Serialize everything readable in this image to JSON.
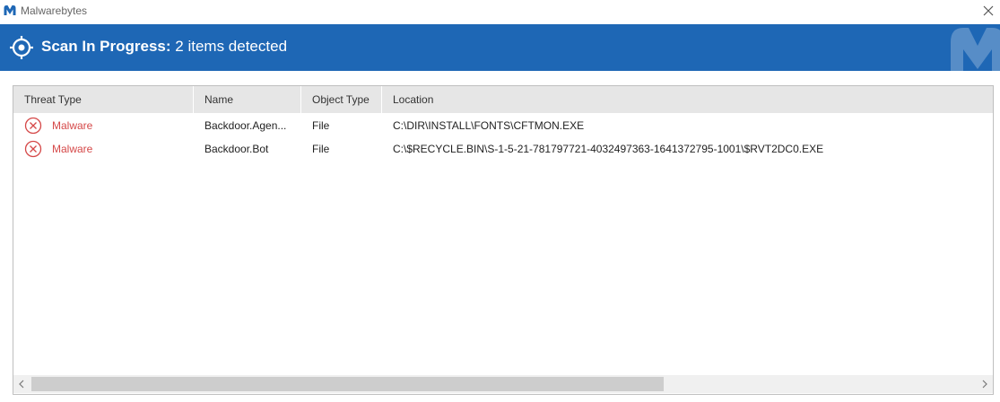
{
  "window": {
    "title": "Malwarebytes",
    "logo_icon": "malwarebytes-logo-icon",
    "close_icon": "close-icon"
  },
  "banner": {
    "status_bold": "Scan In Progress:",
    "status_detail": " 2 items detected",
    "icon": "target-icon",
    "background": "#1e67b5"
  },
  "table": {
    "columns": [
      "Threat Type",
      "Name",
      "Object Type",
      "Location"
    ],
    "rows": [
      {
        "threat_type": "Malware",
        "name": "Backdoor.Agen...",
        "object_type": "File",
        "location": "C:\\DIR\\INSTALL\\FONTS\\CFTMON.EXE"
      },
      {
        "threat_type": "Malware",
        "name": "Backdoor.Bot",
        "object_type": "File",
        "location": "C:\\$RECYCLE.BIN\\S-1-5-21-781797721-4032497363-1641372795-1001\\$RVT2DC0.EXE"
      }
    ],
    "threat_color": "#d54848"
  }
}
